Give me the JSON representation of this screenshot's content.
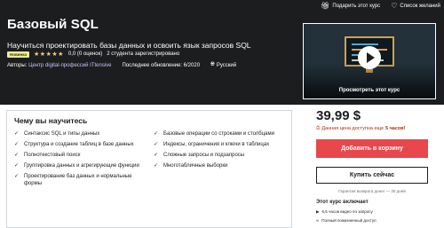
{
  "topbar": {
    "gift_label": "Подарить этот курс",
    "wishlist_label": "Список желаний"
  },
  "course": {
    "title": "Базовый SQL",
    "subtitle": "Научиться проектировать базы данных и освоить язык запросов SQL",
    "badge": "Новинка",
    "stars": "★★★★★",
    "rating": "0,0 (0 оценок)",
    "students": "2 студента зарегистрировано",
    "author_prefix": "Авторы:",
    "author": "Центр digital-профессий ITtensive",
    "updated": "Последнее обновление: 6/2020",
    "language": "Русский"
  },
  "preview": {
    "label": "Просмотреть этот курс"
  },
  "learn": {
    "title": "Чему вы научитесь",
    "left": [
      "Синтаксис SQL и типы данных",
      "Структура и создание таблиц в базе данных",
      "Полнотекстовый поиск",
      "Группировка данных и агрегирующие функции",
      "Проектирование баз данных и нормальные формы"
    ],
    "right": [
      "Базовые операции со строками и столбцами",
      "Индексы, ограничения и ключи в таблицах",
      "Сложные запросы и подзапросы",
      "Многотабличные выборки"
    ]
  },
  "purchase": {
    "price": "39,99 $",
    "deadline_prefix": "Данная цена доступна еще",
    "deadline_value": "5 часов!",
    "add_to_cart": "Добавить в корзину",
    "buy_now": "Купить сейчас",
    "guarantee": "Гарантия возврата денег — 30 дней",
    "includes_title": "Этот курс включает",
    "includes": [
      "6,5 часов видео по запросу",
      "Полный пожизненный доступ"
    ]
  },
  "colors": {
    "hero_bg": "#1c1d1f",
    "cart_button": "#e8474b",
    "badge_bg": "#eceb98",
    "stars": "#f3ca8c",
    "deadline": "#b32d0f"
  }
}
